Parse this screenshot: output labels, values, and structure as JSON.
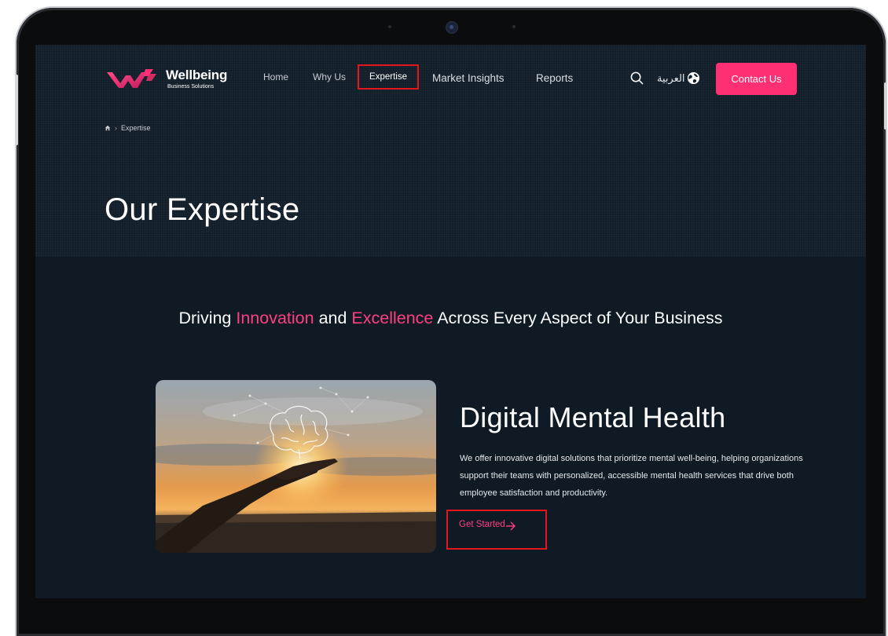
{
  "brand": {
    "name": "Wellbeing",
    "tagline": "Business Solutions",
    "colors": {
      "accent": "#ff2f73",
      "highlight": "#e4151b",
      "background": "#0f1a24"
    }
  },
  "nav": {
    "items": [
      {
        "label": "Home"
      },
      {
        "label": "Why Us"
      },
      {
        "label": "Expertise",
        "active": true
      },
      {
        "label": "Market Insights"
      },
      {
        "label": "Reports"
      }
    ],
    "search_icon": "search-icon",
    "language_label": "العربية",
    "globe_icon": "globe-icon",
    "contact_label": "Contact Us"
  },
  "breadcrumb": {
    "home_icon": "home-icon",
    "current": "Expertise"
  },
  "hero": {
    "title": "Our Expertise"
  },
  "tagline": {
    "part1": "Driving ",
    "highlight1": "Innovation",
    "part2": " and ",
    "highlight2": "Excellence",
    "part3": " Across Every Aspect of Your Business"
  },
  "service": {
    "title": "Digital Mental Health",
    "description": "We offer innovative digital solutions that prioritize mental well-being, helping organizations support their teams with personalized, accessible mental health services that drive both employee satisfaction and productivity.",
    "cta_label": "Get Started",
    "cta_icon": "arrow-right-icon",
    "image_icon": "hand-holding-brain-image"
  }
}
